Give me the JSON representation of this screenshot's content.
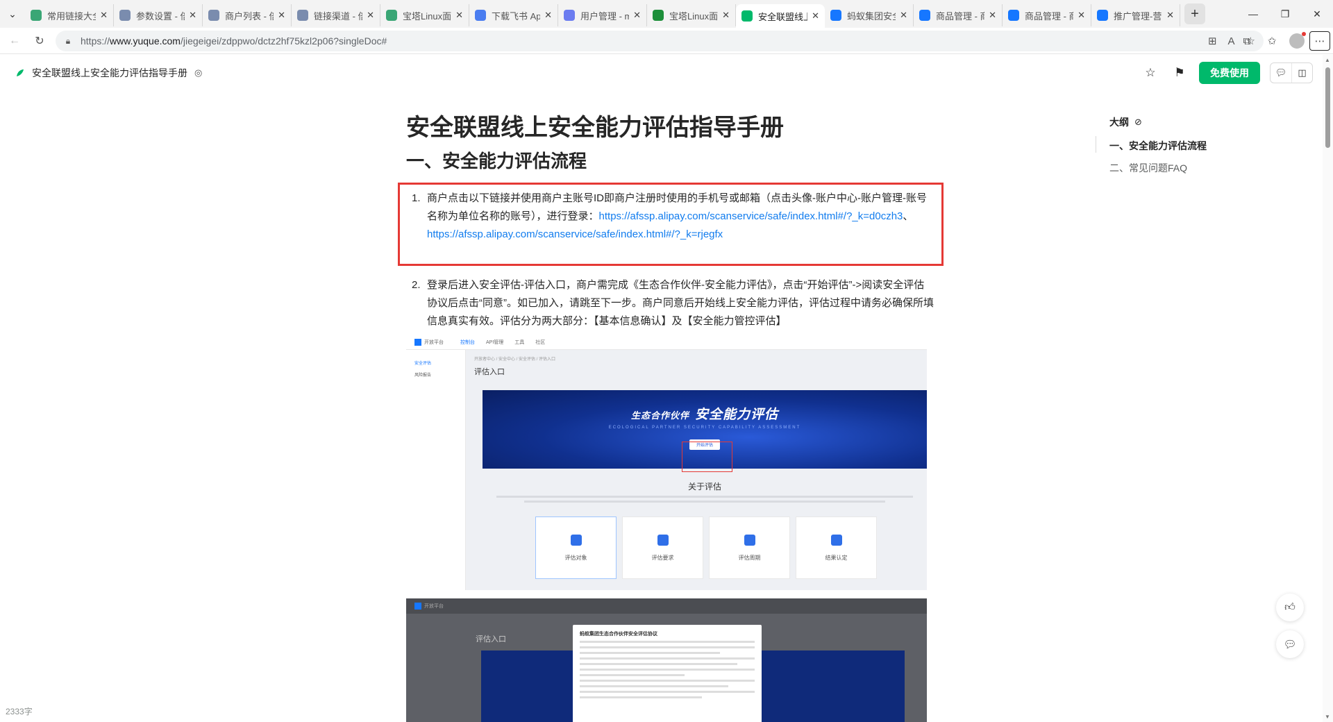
{
  "browser": {
    "tabs": [
      {
        "label": "常用链接大全",
        "color": "#3aa675"
      },
      {
        "label": "参数设置 - 倍",
        "color": "#7a8cae"
      },
      {
        "label": "商户列表 - 倍",
        "color": "#7a8cae"
      },
      {
        "label": "链接渠道 - 倍",
        "color": "#7a8cae"
      },
      {
        "label": "宝塔Linux面板",
        "color": "#3aa675"
      },
      {
        "label": "下载飞书 App",
        "color": "#4a7df0"
      },
      {
        "label": "用户管理 - m",
        "color": "#6b7cf0"
      },
      {
        "label": "宝塔Linux面板",
        "color": "#1d8f3a"
      },
      {
        "label": "安全联盟线上",
        "color": "#00b96b",
        "active": true
      },
      {
        "label": "蚂蚁集团安全",
        "color": "#1677ff"
      },
      {
        "label": "商品管理 - 商",
        "color": "#1677ff"
      },
      {
        "label": "商品管理 - 商",
        "color": "#1677ff"
      },
      {
        "label": "推广管理-营销",
        "color": "#1677ff"
      }
    ],
    "url_prefix": "https://",
    "url_host": "www.yuque.com",
    "url_path": "/jiegeigei/zdppwo/dctz2hf75kzl2p06?singleDoc#"
  },
  "header": {
    "doc_title": "安全联盟线上安全能力评估指导手册",
    "free_button": "免费使用"
  },
  "doc": {
    "title": "安全联盟线上安全能力评估指导手册",
    "section_heading": "一、安全能力评估流程",
    "item1": {
      "num": "1.",
      "text": "商户点击以下链接并使用商户主账号ID即商户注册时使用的手机号或邮箱（点击头像-账户中心-账户管理-账号名称为单位名称的账号），进行登录：",
      "link1": "https://afssp.alipay.com/scanservice/safe/index.html#/?_k=d0czh3",
      "sep": "、",
      "link2": "https://afssp.alipay.com/scanservice/safe/index.html#/?_k=rjegfx"
    },
    "item2": {
      "num": "2.",
      "text": "登录后进入安全评估-评估入口，商户需完成《生态合作伙伴-安全能力评估》，点击“开始评估”->阅读安全评估协议后点击“同意”。如已加入，请跳至下一步。商户同意后开始线上安全能力评估，评估过程中请务必确保所填信息真实有效。评估分为两大部分：【基本信息确认】及【安全能力管控评估】"
    },
    "screenshot1": {
      "brand": "开放平台",
      "nav": [
        "控制台",
        "API管理",
        "工具",
        "社区"
      ],
      "side": [
        "安全评估",
        "风险报告"
      ],
      "crumb": "开放者中心 / 安全中心 / 安全评估 / 评估入口",
      "heading": "评估入口",
      "banner_prefix": "生态合作伙伴",
      "banner_title": "安全能力评估",
      "banner_sub": "ECOLOGICAL PARTNER SECURITY CAPABILITY ASSESSMENT",
      "banner_button": "开始评估",
      "about": "关于评估",
      "cards": [
        "评估对象",
        "评估要求",
        "评估周期",
        "结果认定"
      ]
    },
    "screenshot2": {
      "brand": "开放平台",
      "heading": "评估入口",
      "modal_title": "蚂蚁集团生态合作伙伴安全评估协议"
    }
  },
  "outline": {
    "title": "大纲",
    "items": [
      "一、安全能力评估流程",
      "二、常见问题FAQ"
    ]
  },
  "footer": {
    "word_count": "2333字"
  }
}
